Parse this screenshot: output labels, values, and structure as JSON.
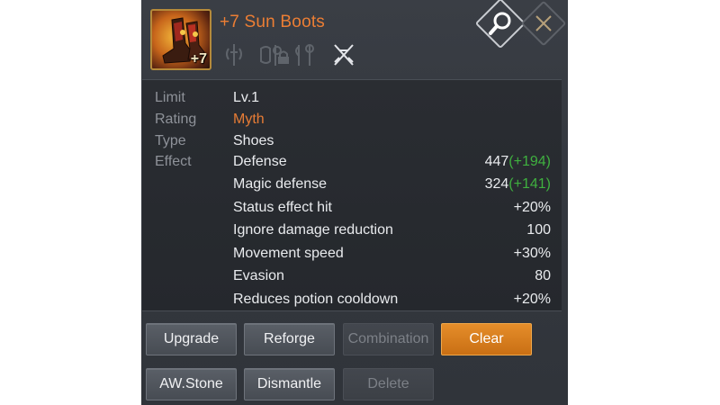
{
  "item": {
    "title": "+7 Sun Boots",
    "icon": "boots-icon",
    "enhance_level": "+7",
    "title_color": "#ec7e34"
  },
  "class_icons": [
    "crossed-swords-icon",
    "shield-mace-icon",
    "lock-icon",
    "axe-staff-icon",
    "crossed-daggers-icon"
  ],
  "header_buttons": {
    "search": "magnifier-icon",
    "close": "close-icon"
  },
  "details": {
    "limit_label": "Limit",
    "limit_value": "Lv.1",
    "rating_label": "Rating",
    "rating_value": "Myth",
    "type_label": "Type",
    "type_value": "Shoes",
    "effect_label": "Effect"
  },
  "effects": [
    {
      "name": "Defense",
      "value": "447",
      "bonus": "(+194)"
    },
    {
      "name": "Magic defense",
      "value": "324",
      "bonus": "(+141)"
    },
    {
      "name": "Status effect hit",
      "value": "+20%",
      "bonus": ""
    },
    {
      "name": "Ignore damage reduction",
      "value": "100",
      "bonus": ""
    },
    {
      "name": "Movement speed",
      "value": "+30%",
      "bonus": ""
    },
    {
      "name": "Evasion",
      "value": "80",
      "bonus": ""
    },
    {
      "name": "Reduces potion cooldown",
      "value": "+20%",
      "bonus": ""
    }
  ],
  "buttons": {
    "upgrade": "Upgrade",
    "reforge": "Reforge",
    "combination": "Combination",
    "clear": "Clear",
    "awstone": "AW.Stone",
    "dismantle": "Dismantle",
    "delete": "Delete"
  },
  "colors": {
    "rating_myth": "#e77c35",
    "bonus_green": "#3fb03f",
    "clear_button": "#d97d1e"
  }
}
